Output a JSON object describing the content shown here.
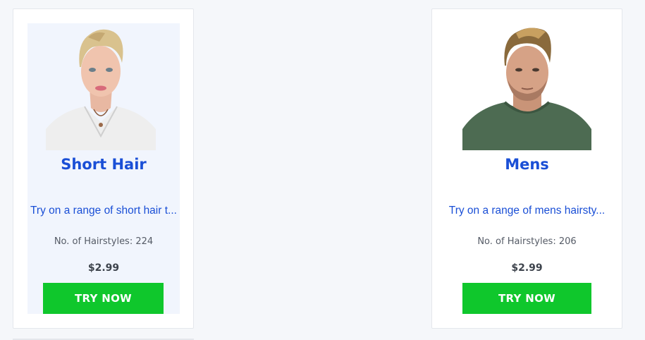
{
  "colors": {
    "title": "#1a4fd6",
    "description": "#1a4fd6",
    "meta_text": "#555b66",
    "price_text": "#3d434c",
    "button_bg": "#0fc72c",
    "highlight_bg": "#f1f5fd"
  },
  "products": [
    {
      "title": "Short Hair",
      "description": "Try on a range of short hair t...",
      "count_text": "No. of Hairstyles: 224",
      "price": "$2.99",
      "button_label": "TRY NOW",
      "image_alt": "woman with short blonde pixie hair"
    },
    {
      "title": "Mens",
      "description": "Try on a range of mens hairsty...",
      "count_text": "No. of Hairstyles: 206",
      "price": "$2.99",
      "button_label": "TRY NOW",
      "image_alt": "man with styled quiff haircut in green sweater"
    }
  ]
}
